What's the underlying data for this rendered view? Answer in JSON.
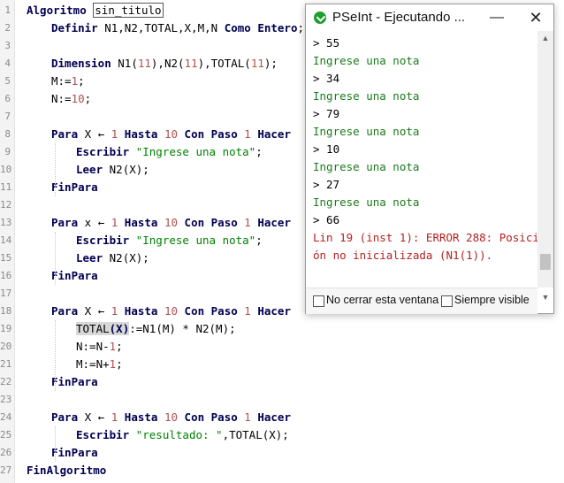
{
  "editor": {
    "lines": [
      {
        "n": "1",
        "t": [
          {
            "k": "kw",
            "v": "Algoritmo "
          },
          {
            "k": "boxed",
            "v": "sin_titulo"
          }
        ]
      },
      {
        "n": "2",
        "t": [
          {
            "k": "kw",
            "v": "Definir "
          },
          {
            "k": "",
            "v": "N1,N2,TOTAL,X,M,N "
          },
          {
            "k": "kw",
            "v": "Como Entero"
          },
          {
            "k": "",
            "v": ";"
          }
        ]
      },
      {
        "n": "3",
        "t": []
      },
      {
        "n": "4",
        "t": [
          {
            "k": "kw",
            "v": "Dimension "
          },
          {
            "k": "",
            "v": "N1("
          },
          {
            "k": "num",
            "v": "11"
          },
          {
            "k": "",
            "v": "),N2("
          },
          {
            "k": "num",
            "v": "11"
          },
          {
            "k": "",
            "v": "),TOTAL("
          },
          {
            "k": "num",
            "v": "11"
          },
          {
            "k": "",
            "v": ");"
          }
        ]
      },
      {
        "n": "5",
        "t": [
          {
            "k": "",
            "v": "M:="
          },
          {
            "k": "num",
            "v": "1"
          },
          {
            "k": "",
            "v": ";"
          }
        ]
      },
      {
        "n": "6",
        "t": [
          {
            "k": "",
            "v": "N:="
          },
          {
            "k": "num",
            "v": "10"
          },
          {
            "k": "",
            "v": ";"
          }
        ]
      },
      {
        "n": "7",
        "t": []
      },
      {
        "n": "8",
        "t": [
          {
            "k": "kw",
            "v": "Para "
          },
          {
            "k": "",
            "v": "X ← "
          },
          {
            "k": "num",
            "v": "1"
          },
          {
            "k": "kw",
            "v": " Hasta "
          },
          {
            "k": "num",
            "v": "10"
          },
          {
            "k": "kw",
            "v": " Con Paso "
          },
          {
            "k": "num",
            "v": "1"
          },
          {
            "k": "kw",
            "v": " Hacer"
          }
        ]
      },
      {
        "n": "9",
        "t": [
          {
            "k": "kw",
            "v": "Escribir "
          },
          {
            "k": "str",
            "v": "\"Ingrese una nota\""
          },
          {
            "k": "",
            "v": ";"
          }
        ]
      },
      {
        "n": "10",
        "t": [
          {
            "k": "kw",
            "v": "Leer "
          },
          {
            "k": "",
            "v": "N2(X);"
          }
        ]
      },
      {
        "n": "11",
        "t": [
          {
            "k": "kw",
            "v": "FinPara"
          }
        ]
      },
      {
        "n": "12",
        "t": []
      },
      {
        "n": "13",
        "t": [
          {
            "k": "kw",
            "v": "Para "
          },
          {
            "k": "",
            "v": "x ← "
          },
          {
            "k": "num",
            "v": "1"
          },
          {
            "k": "kw",
            "v": " Hasta "
          },
          {
            "k": "num",
            "v": "10"
          },
          {
            "k": "kw",
            "v": " Con Paso "
          },
          {
            "k": "num",
            "v": "1"
          },
          {
            "k": "kw",
            "v": " Hacer"
          }
        ]
      },
      {
        "n": "14",
        "t": [
          {
            "k": "kw",
            "v": "Escribir "
          },
          {
            "k": "str",
            "v": "\"Ingrese una nota\""
          },
          {
            "k": "",
            "v": ";"
          }
        ]
      },
      {
        "n": "15",
        "t": [
          {
            "k": "kw",
            "v": "Leer "
          },
          {
            "k": "",
            "v": "N2(X);"
          }
        ]
      },
      {
        "n": "16",
        "t": [
          {
            "k": "kw",
            "v": "FinPara"
          }
        ]
      },
      {
        "n": "17",
        "t": []
      },
      {
        "n": "18",
        "t": [
          {
            "k": "kw",
            "v": "Para "
          },
          {
            "k": "",
            "v": "X ← "
          },
          {
            "k": "num",
            "v": "1"
          },
          {
            "k": "kw",
            "v": " Hasta "
          },
          {
            "k": "num",
            "v": "10"
          },
          {
            "k": "kw",
            "v": " Con Paso "
          },
          {
            "k": "num",
            "v": "1"
          },
          {
            "k": "kw",
            "v": " Hacer"
          }
        ]
      },
      {
        "n": "19",
        "t": [
          {
            "k": "hl",
            "v": "TOTAL"
          },
          {
            "k": "hl kw",
            "v": "(X)"
          },
          {
            "k": "",
            "v": ":=N1(M) * N2(M);"
          }
        ]
      },
      {
        "n": "20",
        "t": [
          {
            "k": "",
            "v": "N:=N-"
          },
          {
            "k": "num",
            "v": "1"
          },
          {
            "k": "",
            "v": ";"
          }
        ]
      },
      {
        "n": "21",
        "t": [
          {
            "k": "",
            "v": "M:=N+"
          },
          {
            "k": "num",
            "v": "1"
          },
          {
            "k": "",
            "v": ";"
          }
        ]
      },
      {
        "n": "22",
        "t": [
          {
            "k": "kw",
            "v": "FinPara"
          }
        ]
      },
      {
        "n": "23",
        "t": []
      },
      {
        "n": "24",
        "t": [
          {
            "k": "kw",
            "v": "Para "
          },
          {
            "k": "",
            "v": "X ← "
          },
          {
            "k": "num",
            "v": "1"
          },
          {
            "k": "kw",
            "v": " Hasta "
          },
          {
            "k": "num",
            "v": "10"
          },
          {
            "k": "kw",
            "v": " Con Paso "
          },
          {
            "k": "num",
            "v": "1"
          },
          {
            "k": "kw",
            "v": " Hacer"
          }
        ]
      },
      {
        "n": "25",
        "t": [
          {
            "k": "kw",
            "v": "Escribir "
          },
          {
            "k": "str",
            "v": "\"resultado: \""
          },
          {
            "k": "",
            "v": ",TOTAL(X);"
          }
        ]
      },
      {
        "n": "26",
        "t": [
          {
            "k": "kw",
            "v": "FinPara"
          }
        ]
      },
      {
        "n": "27",
        "t": [
          {
            "k": "kw",
            "v": "FinAlgoritmo"
          }
        ]
      }
    ]
  },
  "window": {
    "title": "PSeInt - Ejecutando ...",
    "minimize_icon": "minimize-icon",
    "close_icon": "close-icon",
    "console": [
      {
        "k": "c-in",
        "v": "> 55"
      },
      {
        "k": "c-out",
        "v": "Ingrese una nota"
      },
      {
        "k": "c-in",
        "v": "> 34"
      },
      {
        "k": "c-out",
        "v": "Ingrese una nota"
      },
      {
        "k": "c-in",
        "v": "> 79"
      },
      {
        "k": "c-out",
        "v": "Ingrese una nota"
      },
      {
        "k": "c-in",
        "v": "> 10"
      },
      {
        "k": "c-out",
        "v": "Ingrese una nota"
      },
      {
        "k": "c-in",
        "v": "> 27"
      },
      {
        "k": "c-out",
        "v": "Ingrese una nota"
      },
      {
        "k": "c-in",
        "v": "> 66"
      },
      {
        "k": "c-err",
        "v": "Lin 19 (inst 1): ERROR 288: Posici"
      },
      {
        "k": "c-err",
        "v": "ón no inicializada (N1(1))."
      }
    ],
    "checkbox_close": "No cerrar esta ventana",
    "checkbox_visible": "Siempre visible"
  },
  "colors": {
    "keyword": "#000050",
    "number": "#b05050",
    "string": "#008000",
    "error": "#b52020",
    "app_icon": "#1e9e2e"
  }
}
